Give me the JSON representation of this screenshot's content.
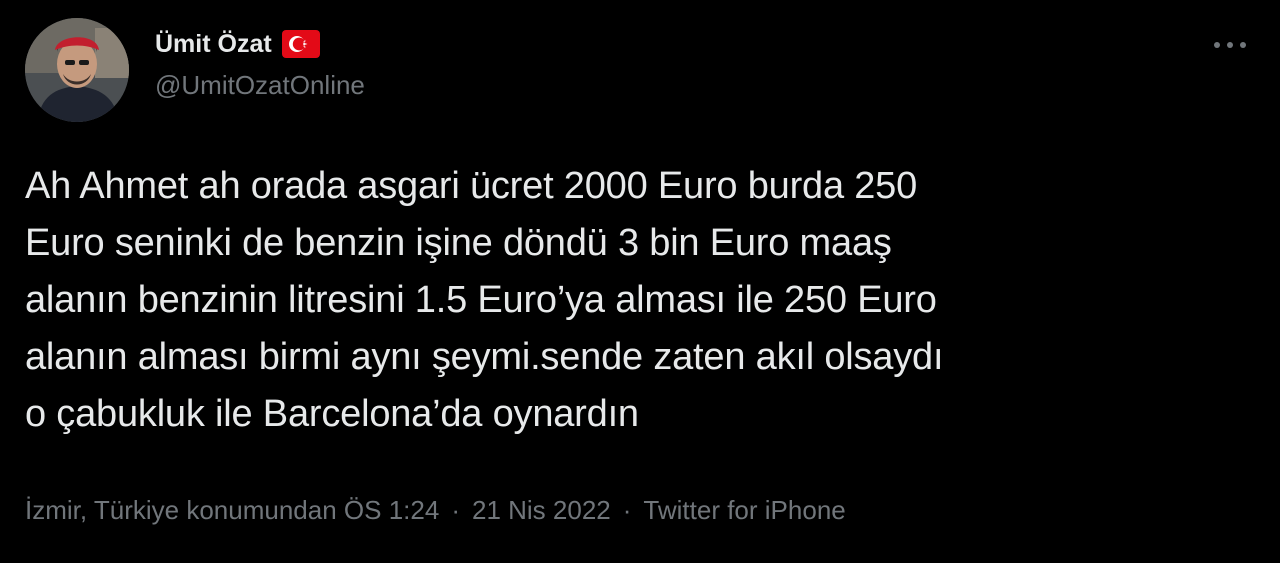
{
  "author": {
    "display_name": "Ümit Özat",
    "flag_icon": "turkey-flag-icon",
    "handle": "@UmitOzatOnline",
    "avatar_icon": "profile-photo"
  },
  "tweet": {
    "text": "Ah Ahmet ah orada asgari ücret 2000 Euro burda 250\nEuro seninki de benzin işine döndü 3 bin Euro maaş\nalanın benzinin litresini 1.5 Euro’ya alması ile 250 Euro\nalanın alması birmi aynı şeymi.sende zaten akıl olsaydı\no çabukluk ile Barcelona’da oynardın",
    "location": "İzmir, Türkiye konumundan",
    "time": "ÖS 1:24",
    "date": "21 Nis 2022",
    "source": "Twitter for iPhone",
    "separator": "·"
  },
  "menu": {
    "more_icon": "more-options-icon"
  },
  "colors": {
    "background": "#000000",
    "primary_text": "#e7e9ea",
    "secondary_text": "#71767b",
    "flag_red": "#e30a17"
  }
}
